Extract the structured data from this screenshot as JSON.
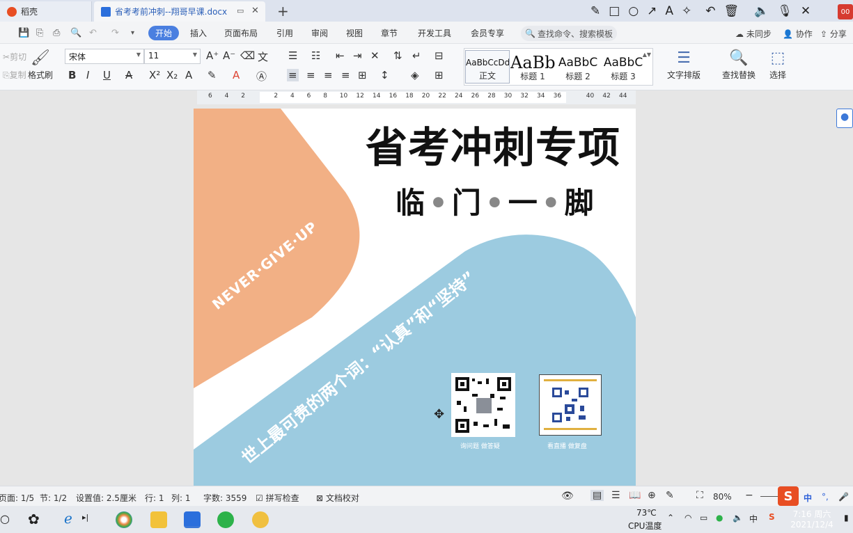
{
  "tabs": {
    "home_label": "稻壳",
    "doc_label": "省考考前冲刺--翔哥早课.docx",
    "add_symbol": "+",
    "close_symbol": "✕"
  },
  "window_badge": "00",
  "menu": {
    "items": [
      "开始",
      "插入",
      "页面布局",
      "引用",
      "审阅",
      "视图",
      "章节",
      "开发工具",
      "会员专享"
    ],
    "search_placeholder": "查找命令、搜索模板",
    "sync": "未同步",
    "collab": "协作",
    "share": "分享"
  },
  "ribbon": {
    "cut": "剪切",
    "copy": "复制",
    "format_painter": "格式刷",
    "font_name": "宋体",
    "font_size": "11",
    "styles": [
      {
        "sample": "AaBbCcDd",
        "name": "正文"
      },
      {
        "sample": "AaBb",
        "name": "标题 1"
      },
      {
        "sample": "AaBbC",
        "name": "标题 2"
      },
      {
        "sample": "AaBbC",
        "name": "标题 3"
      }
    ],
    "text_layout": "文字排版",
    "find_replace": "查找替换",
    "select": "选择"
  },
  "ruler_ticks": [
    "6",
    "4",
    "2",
    "",
    "2",
    "4",
    "6",
    "8",
    "10",
    "12",
    "14",
    "16",
    "18",
    "20",
    "22",
    "24",
    "26",
    "28",
    "30",
    "32",
    "34",
    "36",
    "",
    "40",
    "42",
    "44"
  ],
  "document": {
    "title": "省考冲刺专项",
    "subtitle_chars": [
      "临",
      "门",
      "一",
      "脚"
    ],
    "slogan": "NEVER·GIVE·UP",
    "quote": "世上最可贵的两个词：“认真”和“坚持”",
    "qr_captions": [
      "询问题 做答疑",
      "看直播 做复盘"
    ]
  },
  "status": {
    "page": "页面: 1/5",
    "section": "节: 1/2",
    "setting": "设置值: 2.5厘米",
    "row": "行: 1",
    "col": "列: 1",
    "word_count": "字数: 3559",
    "spell_check": "拼写检查",
    "doc_proof": "文档校对",
    "zoom": "80%"
  },
  "taskbar": {
    "temp": "73℃",
    "cpu": "CPU温度",
    "ime": "中",
    "time": "7:16 周六",
    "date": "2021/12/4"
  },
  "colors": {
    "accent": "#4a7fe0",
    "peach": "#f2b085",
    "blue": "#9ccbe0",
    "wps_red": "#d63a2f"
  }
}
